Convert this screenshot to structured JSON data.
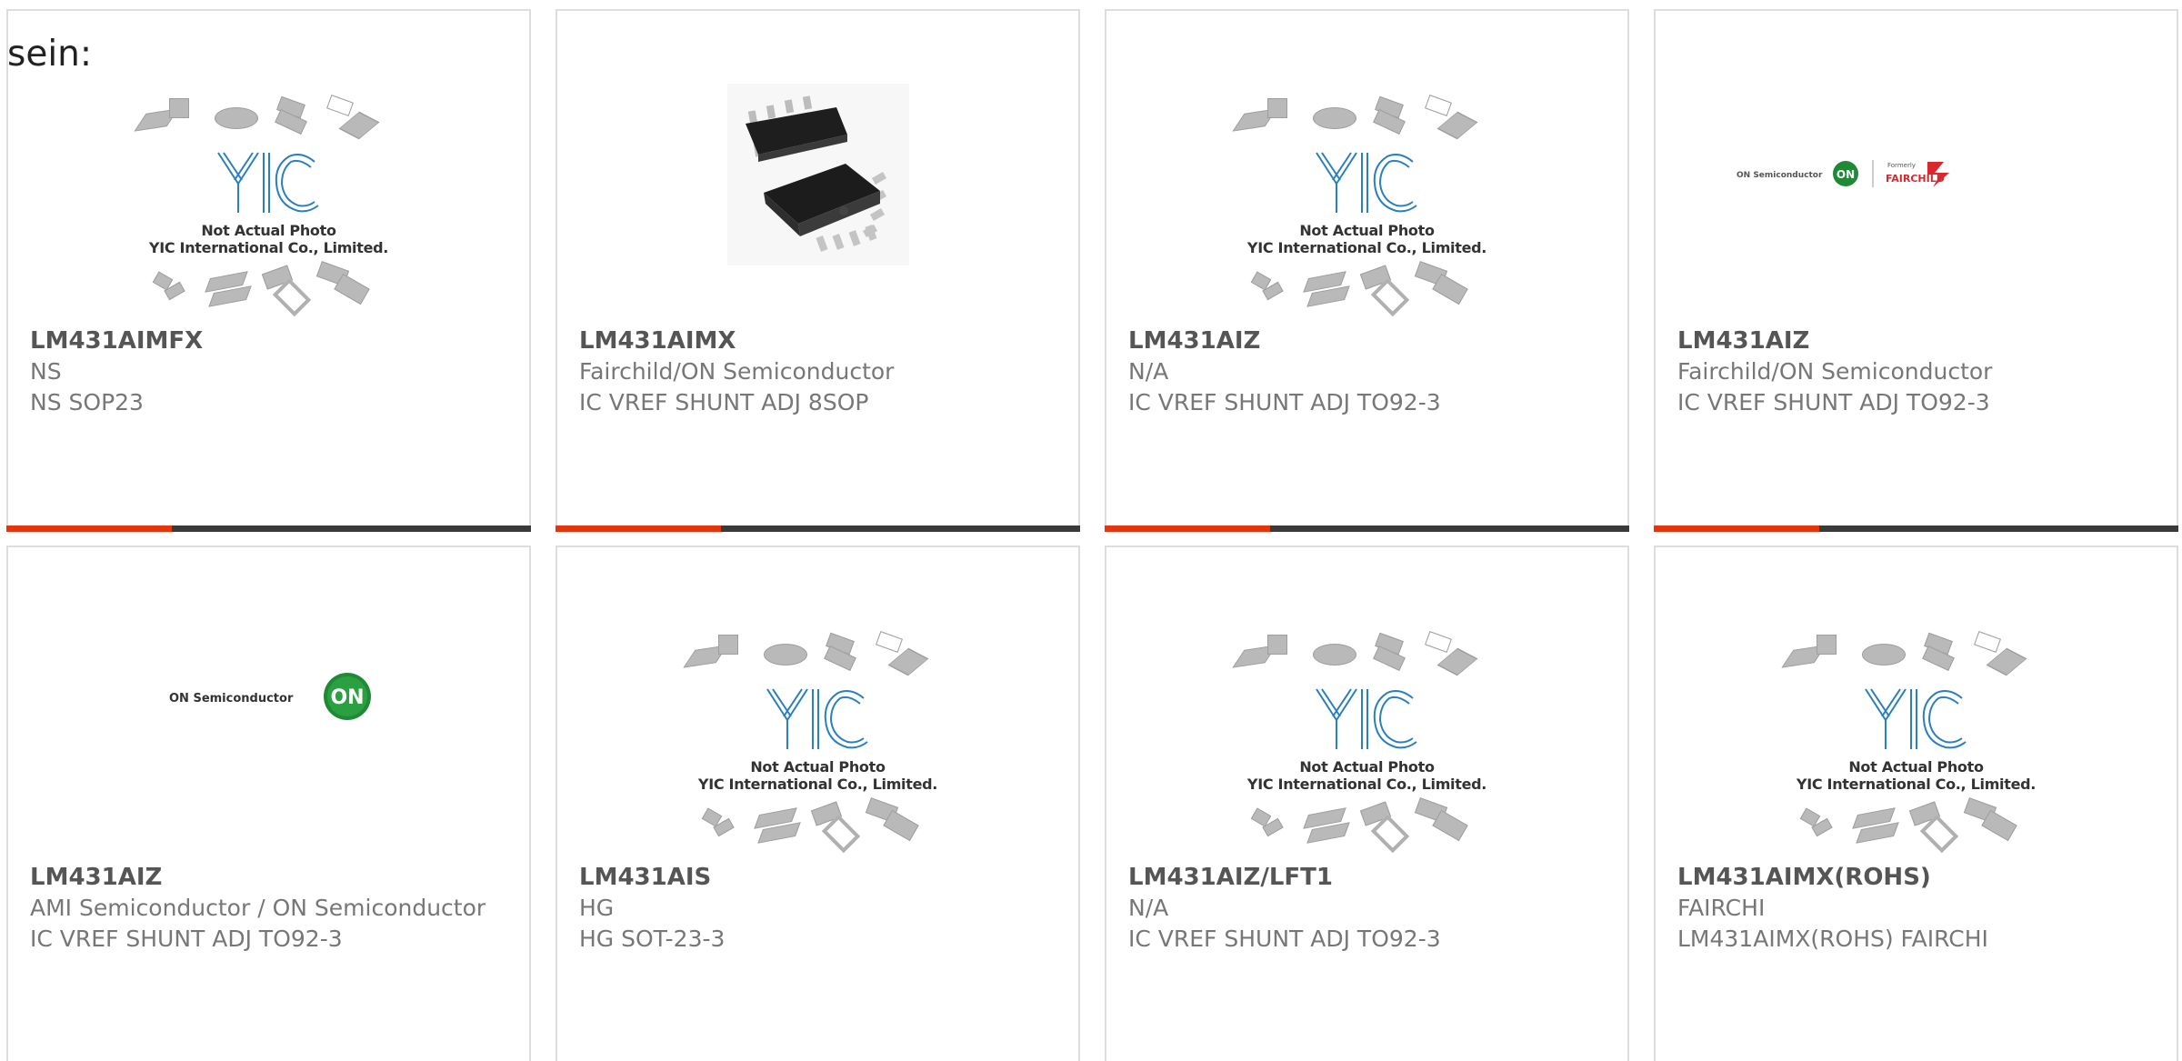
{
  "lead_text": "sein:",
  "image_placeholder": {
    "caption_line1": "Not Actual Photo",
    "caption_line2": "YIC International Co., Limited.",
    "logo_text": "YIC"
  },
  "colors": {
    "accent": "#e2360f",
    "bar": "#3a3a3a",
    "title": "#555555",
    "text": "#777777",
    "on_green": "#1f8a35",
    "fairchild_red": "#d9272e"
  },
  "products": [
    {
      "part": "LM431AIMFX",
      "maker": "NS",
      "desc": "NS SOP23",
      "image": "yic-placeholder-icon"
    },
    {
      "part": "LM431AIMX",
      "maker": "Fairchild/ON Semiconductor",
      "desc": "IC VREF SHUNT ADJ 8SOP",
      "image": "sop8-package-icon"
    },
    {
      "part": "LM431AIZ",
      "maker": "N/A",
      "desc": "IC VREF SHUNT ADJ TO92-3",
      "image": "yic-placeholder-icon"
    },
    {
      "part": "LM431AIZ",
      "maker": "Fairchild/ON Semiconductor",
      "desc": "IC VREF SHUNT ADJ TO92-3",
      "image": "fairchild-on-logo-icon"
    },
    {
      "part": "LM431AIZ",
      "maker": "AMI Semiconductor / ON Semiconductor",
      "desc": "IC VREF SHUNT ADJ TO92-3",
      "image": "on-semiconductor-logo-icon"
    },
    {
      "part": "LM431AIS",
      "maker": "HG",
      "desc": "HG SOT-23-3",
      "image": "yic-placeholder-icon"
    },
    {
      "part": "LM431AIZ/LFT1",
      "maker": "N/A",
      "desc": "IC VREF SHUNT ADJ TO92-3",
      "image": "yic-placeholder-icon"
    },
    {
      "part": "LM431AIMX(ROHS)",
      "maker": "FAIRCHI",
      "desc": "LM431AIMX(ROHS) FAIRCHI",
      "image": "yic-placeholder-icon"
    }
  ],
  "logos": {
    "on_semiconductor": "ON Semiconductor",
    "on_small": "ON Semiconductor",
    "on_badge": "ON",
    "formerly": "Formerly",
    "fairchild": "FAIRCHILD"
  }
}
